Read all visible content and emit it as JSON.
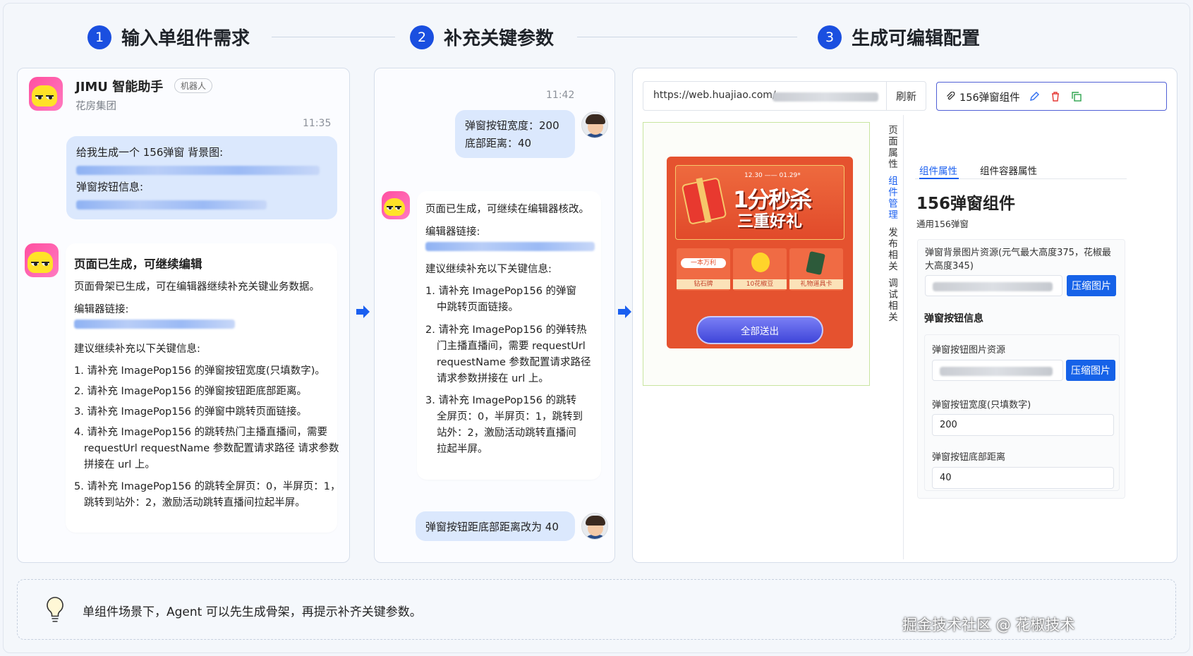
{
  "steps": [
    {
      "num": "1",
      "title": "输入单组件需求"
    },
    {
      "num": "2",
      "title": "补充关键参数"
    },
    {
      "num": "3",
      "title": "生成可编辑配置"
    }
  ],
  "panel1": {
    "bot_name": "JIMU 智能助手",
    "bot_badge": "机器人",
    "bot_org": "花房集团",
    "time": "11:35",
    "user_msg_line1": "给我生成一个 156弹窗 背景图:",
    "user_msg_line2": "弹窗按钮信息:",
    "reply_title": "页面已生成，可继续编辑",
    "reply_desc": "页面骨架已生成，可在编辑器继续补充关键业务数据。",
    "editor_link_label": "编辑器链接:",
    "suggest_title": "建议继续补充以下关键信息:",
    "items": [
      "1. 请补充 ImagePop156 的弹窗按钮宽度(只填数字)。",
      "2. 请补充 ImagePop156 的弹窗按钮距底部距离。",
      "3. 请补充 ImagePop156 的弹窗中跳转页面链接。",
      "4. 请补充 ImagePop156 的跳转热门主播直播间，需要",
      "requestUrl requestName 参数配置请求路径 请求参数",
      "拼接在 url 上。",
      "5. 请补充 ImagePop156 的跳转全屏页：0，半屏页：1，",
      "跳转到站外：2，激励活动跳转直播间拉起半屏。"
    ]
  },
  "panel2": {
    "time": "11:42",
    "user_msg_line1": "弹窗按钮宽度：200",
    "user_msg_line2": "底部距离：40",
    "reply_line1": "页面已生成，可继续在编辑器核改。",
    "editor_link_label": "编辑器链接:",
    "suggest_title": "建议继续补充以下关键信息:",
    "items": [
      "1. 请补充 ImagePop156 的弹窗",
      "中跳转页面链接。",
      "2. 请补充 ImagePop156 的弹转热",
      "门主播直播间，需要 requestUrl",
      "requestName 参数配置请求路径",
      "请求参数拼接在 url 上。",
      "3. 请补充 ImagePop156 的跳转",
      "全屏页：0，半屏页：1，跳转到",
      "站外：2，激励活动跳转直播间",
      "拉起半屏。"
    ],
    "user_msg2": "弹窗按钮距底部距离改为 40"
  },
  "panel3": {
    "url_prefix": "https://web.huajiao.com/",
    "refresh_label": "刷新",
    "component_chip": "156弹窗组件",
    "vertical_tabs": [
      "页面属性",
      "组件管理",
      "发布相关",
      "调试相关"
    ],
    "tabs": [
      "组件属性",
      "组件容器属性"
    ],
    "component_title": "156弹窗组件",
    "component_subtitle": "通用156弹窗",
    "bg_label": "弹窗背景图片资源(元气最大高度375，花椒最大高度345)",
    "compress_label": "压缩图片",
    "btn_section_title": "弹窗按钮信息",
    "btn_img_label": "弹窗按钮图片资源",
    "compress_label2": "压缩图片",
    "btn_width_label": "弹窗按钮宽度(只填数字)",
    "btn_width_value": "200",
    "btn_bottom_label": "弹窗按钮底部距离",
    "btn_bottom_value": "40",
    "popup": {
      "banner_line1": "1分秒杀",
      "banner_line2": "三重好礼",
      "date_text": "12.30 —— 01.29*",
      "prizes": [
        "一本万利",
        "10花椒豆",
        "礼物道具卡"
      ],
      "prize_captions": [
        "钻石牌",
        "10花椒豆",
        "礼物道具卡"
      ],
      "button_text": "全部送出"
    }
  },
  "footer": {
    "tip": "单组件场景下，Agent 可以先生成骨架，再提示补齐关键参数。",
    "watermark": "掘金技术社区 @ 花椒技术"
  },
  "colors": {
    "accent": "#1a4fe0",
    "bubble_blue": "#dbe8fd",
    "popup_red": "#e5522f",
    "popup_button": "#4f55e8"
  }
}
